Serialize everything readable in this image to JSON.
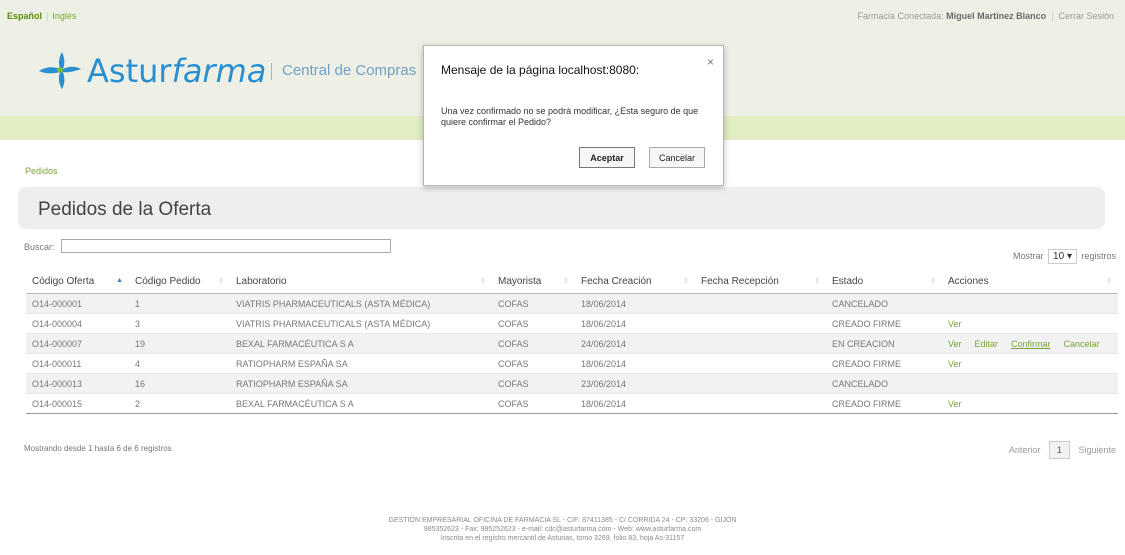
{
  "topbar": {
    "lang_active": "Español",
    "lang_alt": "Inglés",
    "connected_label": "Farmacia Conectada:",
    "connected_user": "Miguel Martínez Blanco",
    "logout": "Cerrar Sesión"
  },
  "header": {
    "brand_a": "Astur",
    "brand_b": "farma",
    "central": "Central de Compras"
  },
  "breadcrumb": "Pedidos",
  "page_title": "Pedidos de la Oferta",
  "search": {
    "label": "Buscar:",
    "value": ""
  },
  "length": {
    "prefix": "Mostrar",
    "value": "10",
    "suffix": "registros"
  },
  "table": {
    "headers": [
      "Código Oferta",
      "Código Pedido",
      "Laboratorio",
      "Mayorista",
      "Fecha Creación",
      "Fecha Recepción",
      "Estado",
      "Acciones"
    ],
    "rows": [
      {
        "oferta": "O14-000001",
        "pedido": "1",
        "lab": "VIATRIS PHARMACEUTICALS (ASTA MÉDICA)",
        "mayorista": "COFAS",
        "creacion": "18/06/2014",
        "recepcion": "",
        "estado": "CANCELADO",
        "actions": []
      },
      {
        "oferta": "O14-000004",
        "pedido": "3",
        "lab": "VIATRIS PHARMACEUTICALS (ASTA MÉDICA)",
        "mayorista": "COFAS",
        "creacion": "18/06/2014",
        "recepcion": "",
        "estado": "CREADO FIRME",
        "actions": [
          "Ver"
        ]
      },
      {
        "oferta": "O14-000007",
        "pedido": "19",
        "lab": "BEXAL FARMACÉUTICA S A",
        "mayorista": "COFAS",
        "creacion": "24/06/2014",
        "recepcion": "",
        "estado": "EN CREACION",
        "actions": [
          "Ver",
          "Editar",
          "Confirmar",
          "Cancelar"
        ]
      },
      {
        "oferta": "O14-000011",
        "pedido": "4",
        "lab": "RATIOPHARM ESPAÑA SA",
        "mayorista": "COFAS",
        "creacion": "18/06/2014",
        "recepcion": "",
        "estado": "CREADO FIRME",
        "actions": [
          "Ver"
        ]
      },
      {
        "oferta": "O14-000013",
        "pedido": "16",
        "lab": "RATIOPHARM ESPAÑA SA",
        "mayorista": "COFAS",
        "creacion": "23/06/2014",
        "recepcion": "",
        "estado": "CANCELADO",
        "actions": []
      },
      {
        "oferta": "O14-000015",
        "pedido": "2",
        "lab": "BEXAL FARMACÉUTICA S A",
        "mayorista": "COFAS",
        "creacion": "18/06/2014",
        "recepcion": "",
        "estado": "CREADO FIRME",
        "actions": [
          "Ver"
        ]
      }
    ]
  },
  "info": "Mostrando desde 1 hasta 6 de 6 registros",
  "paging": {
    "prev": "Anterior",
    "page": "1",
    "next": "Siguiente"
  },
  "footer": {
    "line1": "GESTIÓN EMPRESARIAL OFICINA DE FARMACIA SL - CIF: 87411385 - C/ CORRIDA 24 - CP: 33206 - GIJÓN",
    "line2": "985352623 - Fax: 985252623 - e-mail: cdc@asturfarma.com - Web: www.asturfarma.com",
    "line3": "Inscrita en el registro mercantil de Asturias, tomo 3269, folio 83, hoja As-31157"
  },
  "dialog": {
    "title": "Mensaje de la página localhost:8080:",
    "message": "Una vez confirmado no se podrá modificar, ¿Esta seguro de que quiere confirmar el Pedido?",
    "ok": "Aceptar",
    "cancel": "Cancelar",
    "close": "×"
  },
  "colors": {
    "accent_green": "#7aa33a",
    "brand_blue": "#2a8fd0",
    "header_bg": "#eef0e6",
    "nav_bg": "#e1edc2"
  }
}
